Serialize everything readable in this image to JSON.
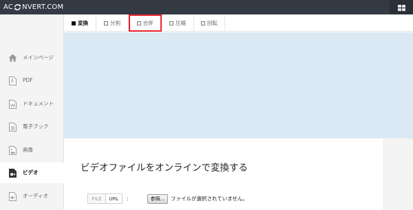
{
  "header": {
    "logo_left": "AC",
    "logo_right": "NVERT.COM",
    "logo_mark": "refresh-arrows-icon",
    "menu_icon": "grid-menu-icon"
  },
  "sidebar": {
    "items": [
      {
        "label": "メインページ",
        "icon": "home-icon"
      },
      {
        "label": "PDF",
        "icon": "pdf-file-icon"
      },
      {
        "label": "ドキュメント",
        "icon": "word-document-icon"
      },
      {
        "label": "電子ブック",
        "icon": "ebook-icon"
      },
      {
        "label": "画像",
        "icon": "image-icon"
      },
      {
        "label": "ビデオ",
        "icon": "video-icon"
      },
      {
        "label": "オーディオ",
        "icon": "audio-icon"
      }
    ],
    "active_index": 5
  },
  "tabs": {
    "items": [
      {
        "label": "変換"
      },
      {
        "label": "分割"
      },
      {
        "label": "合併"
      },
      {
        "label": "圧縮"
      },
      {
        "label": "回転"
      }
    ],
    "active_index": 0,
    "highlighted_index": 2,
    "highlight_color": "#e8202a"
  },
  "main": {
    "heading": "ビデオファイルをオンラインで変換する",
    "source_file": "FILE",
    "source_url": "URL",
    "colon": ":",
    "browse_button": "参照...",
    "no_file_text": "ファイルが選択されていません。"
  },
  "colors": {
    "topbar": "#333a44",
    "banner": "#dbe9f4",
    "sidebar": "#f4f4f4"
  }
}
